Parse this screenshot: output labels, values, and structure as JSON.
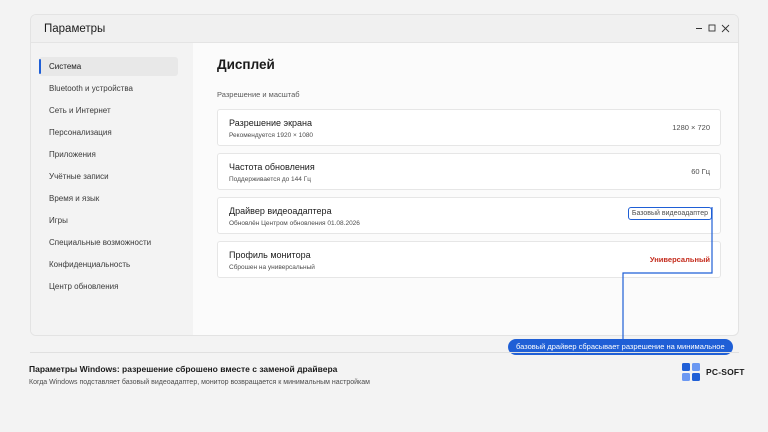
{
  "window": {
    "title": "Параметры",
    "controls": [
      "minimize-icon",
      "maximize-icon",
      "close-icon"
    ]
  },
  "sidebar": {
    "items": [
      {
        "label": "Система",
        "active": true
      },
      {
        "label": "Bluetooth и устройства"
      },
      {
        "label": "Сеть и Интернет"
      },
      {
        "label": "Персонализация"
      },
      {
        "label": "Приложения"
      },
      {
        "label": "Учётные записи"
      },
      {
        "label": "Время и язык"
      },
      {
        "label": "Игры"
      },
      {
        "label": "Специальные возможности"
      },
      {
        "label": "Конфиденциальность"
      },
      {
        "label": "Центр обновления"
      }
    ]
  },
  "main": {
    "title": "Дисплей",
    "subtitle": "Разрешение и масштаб",
    "cards": [
      {
        "title": "Разрешение экрана",
        "desc": "Рекомендуется 1920 × 1080",
        "value": "1280 × 720"
      },
      {
        "title": "Частота обновления",
        "desc": "Поддерживается до 144 Гц",
        "value": "60 Гц"
      },
      {
        "title": "Драйвер видеоадаптера",
        "desc": "Обновлён Центром обновления 01.08.2026",
        "value": "Базовый видеоадаптер"
      },
      {
        "title": "Профиль монитора",
        "desc": "Сброшен на универсальный",
        "value": "Универсальный"
      }
    ]
  },
  "annotation": {
    "callout": "базовый драйвер сбрасывает разрешение на минимальное"
  },
  "caption": {
    "title": "Параметры Windows: разрешение сброшено вместе с заменой драйвера",
    "subtitle": "Когда Windows подставляет базовый видеоадаптер, монитор возвращается к минимальным настройкам"
  },
  "brand": {
    "name": "PC-SOFT",
    "colors": [
      "#1f5fd6",
      "#5b8ff0",
      "#5b8ff0",
      "#1f5fd6"
    ]
  },
  "colors": {
    "accent": "#1f5fd6",
    "warning": "#c42b1c"
  }
}
